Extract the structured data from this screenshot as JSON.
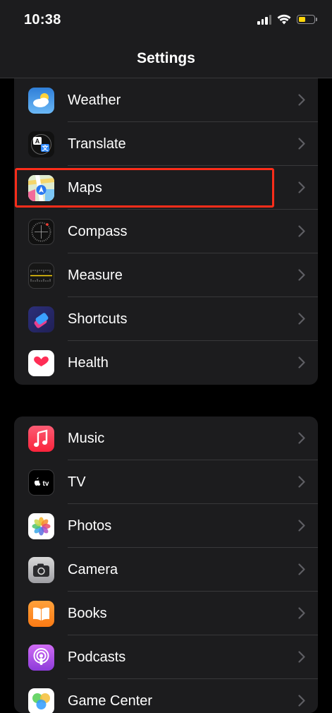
{
  "status": {
    "time": "10:38",
    "battery_level": 0.45
  },
  "nav": {
    "title": "Settings"
  },
  "group1": [
    {
      "label": "Weather",
      "icon": "weather-icon"
    },
    {
      "label": "Translate",
      "icon": "translate-icon"
    },
    {
      "label": "Maps",
      "icon": "maps-icon"
    },
    {
      "label": "Compass",
      "icon": "compass-icon"
    },
    {
      "label": "Measure",
      "icon": "measure-icon"
    },
    {
      "label": "Shortcuts",
      "icon": "shortcuts-icon"
    },
    {
      "label": "Health",
      "icon": "health-icon"
    }
  ],
  "group2": [
    {
      "label": "Music",
      "icon": "music-icon"
    },
    {
      "label": "TV",
      "icon": "tv-icon"
    },
    {
      "label": "Photos",
      "icon": "photos-icon"
    },
    {
      "label": "Camera",
      "icon": "camera-icon"
    },
    {
      "label": "Books",
      "icon": "books-icon"
    },
    {
      "label": "Podcasts",
      "icon": "podcasts-icon"
    },
    {
      "label": "Game Center",
      "icon": "game-center-icon"
    }
  ],
  "highlight": {
    "target": "Maps",
    "color": "#ff2d1a"
  }
}
